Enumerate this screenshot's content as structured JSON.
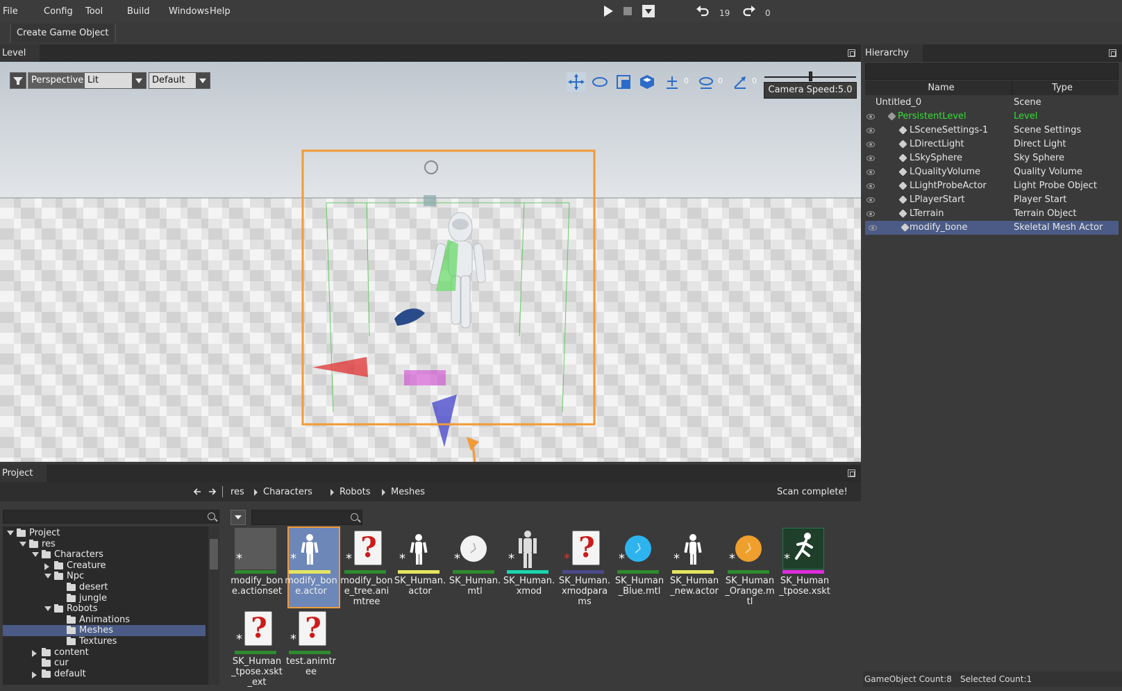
{
  "menu": [
    "File",
    "Config",
    "Tool",
    "Build",
    "Windows",
    "Help"
  ],
  "transport": {
    "undo_count": "19",
    "redo_count": "0"
  },
  "toolbar": {
    "create_label": "Create Game Object"
  },
  "level_panel": {
    "tab": "Level",
    "view_mode": "Perspective",
    "shading": "Lit",
    "layout": "Default",
    "gizmo_values": [
      "0",
      "0",
      "0"
    ],
    "camera_speed": "Camera Speed:5.0",
    "camera_speed_fraction": 0.5
  },
  "hierarchy": {
    "tab": "Hierarchy",
    "columns": {
      "name": "Name",
      "type": "Type"
    },
    "rows": [
      {
        "name": "Untitled_0",
        "type": "Scene"
      },
      {
        "name": "PersistentLevel",
        "type": "Level"
      },
      {
        "name": "LSceneSettings-1",
        "type": "Scene Settings"
      },
      {
        "name": "LDirectLight",
        "type": "Direct Light"
      },
      {
        "name": "LSkySphere",
        "type": "Sky Sphere"
      },
      {
        "name": "LQualityVolume",
        "type": "Quality Volume"
      },
      {
        "name": "LLightProbeActor",
        "type": "Light Probe Object"
      },
      {
        "name": "LPlayerStart",
        "type": "Player Start"
      },
      {
        "name": "LTerrain",
        "type": "Terrain Object"
      },
      {
        "name": "modify_bone",
        "type": "Skeletal Mesh Actor"
      }
    ],
    "status": {
      "count": "GameObject Count:8",
      "selected": "Selected Count:1"
    }
  },
  "project": {
    "tab": "Project",
    "breadcrumb": [
      "res",
      "Characters",
      "Robots",
      "Meshes"
    ],
    "scan_status": "Scan complete!",
    "tree": [
      {
        "label": "Project"
      },
      {
        "label": "res"
      },
      {
        "label": "Characters"
      },
      {
        "label": "Creature"
      },
      {
        "label": "Npc"
      },
      {
        "label": "desert"
      },
      {
        "label": "jungle"
      },
      {
        "label": "Robots"
      },
      {
        "label": "Animations"
      },
      {
        "label": "Meshes"
      },
      {
        "label": "Textures"
      },
      {
        "label": "content"
      },
      {
        "label": "cur"
      },
      {
        "label": "default"
      }
    ],
    "assets": [
      {
        "name": "modify_bone.actionset",
        "bar": "#2e8b2e",
        "icon": "blank-thumb-icon"
      },
      {
        "name": "modify_bone.actor",
        "bar": "#e6e660",
        "icon": "actor-figure-icon"
      },
      {
        "name": "modify_bone_tree.animtree",
        "bar": "#2e8b2e",
        "icon": "unknown-file-icon"
      },
      {
        "name": "SK_Human.actor",
        "bar": "#e6e660",
        "icon": "actor-figure-icon"
      },
      {
        "name": "SK_Human.mtl",
        "bar": "#2e8b2e",
        "icon": "material-white-icon"
      },
      {
        "name": "SK_Human.xmod",
        "bar": "#1ad6b0",
        "icon": "mesh-figure-icon"
      },
      {
        "name": "SK_Human.xmodparams",
        "bar": "#4a4a8a",
        "icon": "unknown-file-icon"
      },
      {
        "name": "SK_Human_Blue.mtl",
        "bar": "#2e8b2e",
        "icon": "material-blue-icon"
      },
      {
        "name": "SK_Human_new.actor",
        "bar": "#e6e660",
        "icon": "actor-figure-icon"
      },
      {
        "name": "SK_Human_Orange.mtl",
        "bar": "#2e8b2e",
        "icon": "material-orange-icon"
      },
      {
        "name": "SK_Human_tpose.xskt",
        "bar": "#e02ce0",
        "icon": "skeleton-runner-icon"
      },
      {
        "name": "SK_Human_tpose.xskt_ext",
        "bar": "#2e8b2e",
        "icon": "unknown-file-icon"
      },
      {
        "name": "test.animtree",
        "bar": "#2e8b2e",
        "icon": "unknown-file-icon"
      }
    ]
  }
}
